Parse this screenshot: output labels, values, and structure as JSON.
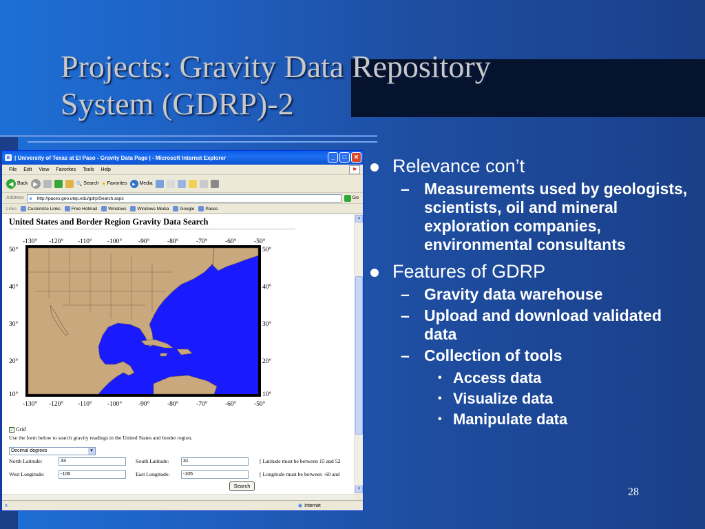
{
  "slide": {
    "title_line1": "Projects: Gravity Data Repository",
    "title_line2": "System (GDRP)-2",
    "page_number": "28"
  },
  "browser": {
    "window_title": "| University of Texas at El Paso - Gravity Data Page | - Microsoft Internet Explorer",
    "menu": [
      "File",
      "Edit",
      "View",
      "Favorites",
      "Tools",
      "Help"
    ],
    "toolbar": {
      "back": "Back",
      "search": "Search",
      "favorites": "Favorites",
      "media": "Media"
    },
    "address_label": "Address",
    "address_value": "http://paces.geo.utep.edu/gdrp/Search.aspx",
    "go_label": "Go",
    "links_label": "Links",
    "links": [
      "Customize Links",
      "Free Hotmail",
      "Windows",
      "Windows Media",
      "Google",
      "Paces"
    ],
    "status_zone": "Internet"
  },
  "page": {
    "heading": "United States and Border Region Gravity Data Search",
    "map": {
      "lon_labels": [
        "-130°",
        "-120°",
        "-110°",
        "-100°",
        "-90°",
        "-80°",
        "-70°",
        "-60°",
        "-50°"
      ],
      "lat_labels": [
        "50°",
        "40°",
        "30°",
        "20°",
        "10°"
      ]
    },
    "grid_label": "Grid",
    "grid_checked": true,
    "instructions": "Use the form below to search gravity readings in the United States and border region.",
    "coord_format": "Decimal degrees",
    "north_label": "North Latitude:",
    "north_value": "33",
    "south_label": "South Latitude:",
    "south_value": "31",
    "lat_note": "[ Latitude must be between 15 and 52",
    "west_label": "West Longitude:",
    "west_value": "-106",
    "east_label": "East Longitude:",
    "east_value": "-105",
    "lon_note": "[ Longitude must be between -60 and",
    "search_button": "Search"
  },
  "bullets": {
    "relevance": "Relevance con’t",
    "relevance_sub": "Measurements used by geologists, scientists, oil and mineral exploration companies, environmental consultants",
    "features": "Features of GDRP",
    "features_subs": [
      "Gravity data warehouse",
      "Upload and download validated data",
      "Collection of tools"
    ],
    "tools": [
      "Access data",
      "Visualize data",
      "Manipulate data"
    ]
  },
  "colors": {
    "ocean": "#1a1aff",
    "land": "#c8a87c",
    "slide_bg": "#1f5fc0"
  }
}
